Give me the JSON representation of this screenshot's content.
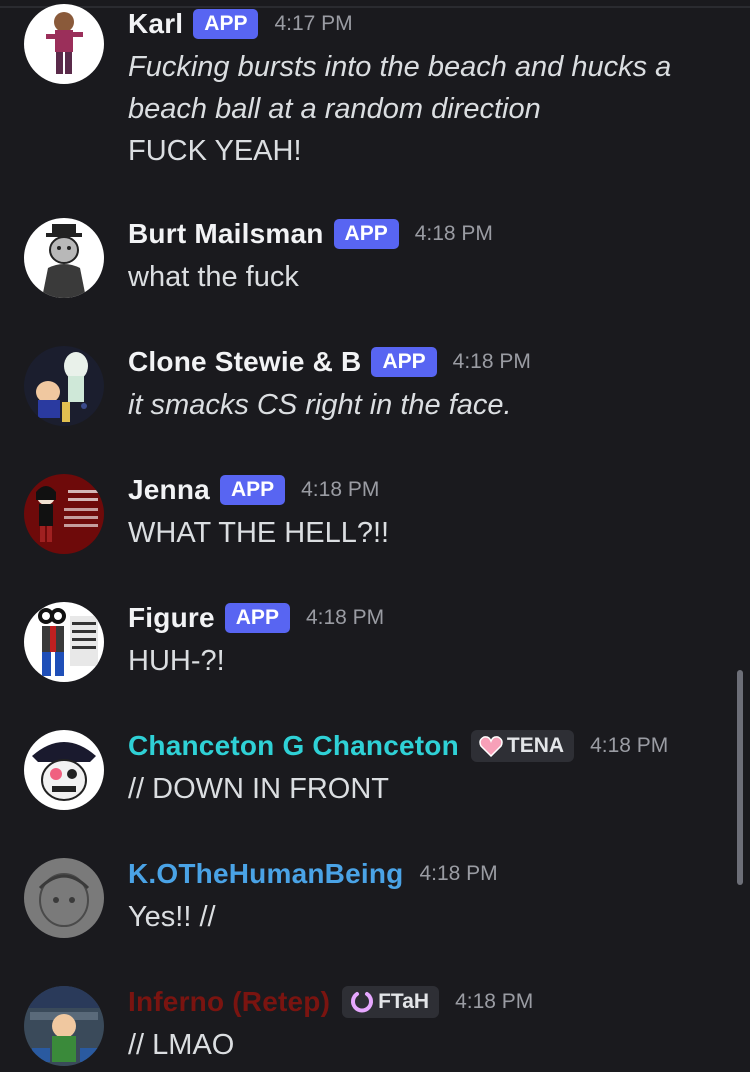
{
  "messages": [
    {
      "username": "Karl",
      "username_color": "#f2f3f5",
      "badge": "APP",
      "time": "4:17 PM",
      "lines": [
        "Fucking bursts into the beach and hucks a",
        "beach ball at a random direction",
        "FUCK YEAH!"
      ],
      "italic_lines": [
        0,
        1
      ]
    },
    {
      "username": "Burt Mailsman",
      "username_color": "#f2f3f5",
      "badge": "APP",
      "time": "4:18 PM",
      "lines": [
        "what the fuck"
      ]
    },
    {
      "username": "Clone Stewie & B",
      "username_color": "#f2f3f5",
      "badge": "APP",
      "time": "4:18 PM",
      "lines": [
        "it smacks CS right in the face."
      ],
      "italic_lines": [
        0
      ]
    },
    {
      "username": "Jenna",
      "username_color": "#f2f3f5",
      "badge": "APP",
      "time": "4:18 PM",
      "lines": [
        "WHAT THE HELL?!!"
      ]
    },
    {
      "username": "Figure",
      "username_color": "#f2f3f5",
      "badge": "APP",
      "time": "4:18 PM",
      "lines": [
        "HUH-?!"
      ]
    },
    {
      "username": "Chanceton G Chanceton",
      "username_color": "#2fd1d6",
      "tag": "TENA",
      "tag_icon": "pink-heart-icon",
      "time": "4:18 PM",
      "lines": [
        "// DOWN IN FRONT"
      ]
    },
    {
      "username": "K.OTheHumanBeing",
      "username_color": "#4aa3e6",
      "time": "4:18 PM",
      "lines": [
        "Yes!! //"
      ]
    },
    {
      "username": "Inferno (Retep)",
      "username_color": "#7a1410",
      "tag": "FTaH",
      "tag_icon": "purple-ring-icon",
      "time": "4:18 PM",
      "lines": [
        "// LMAO"
      ]
    }
  ]
}
